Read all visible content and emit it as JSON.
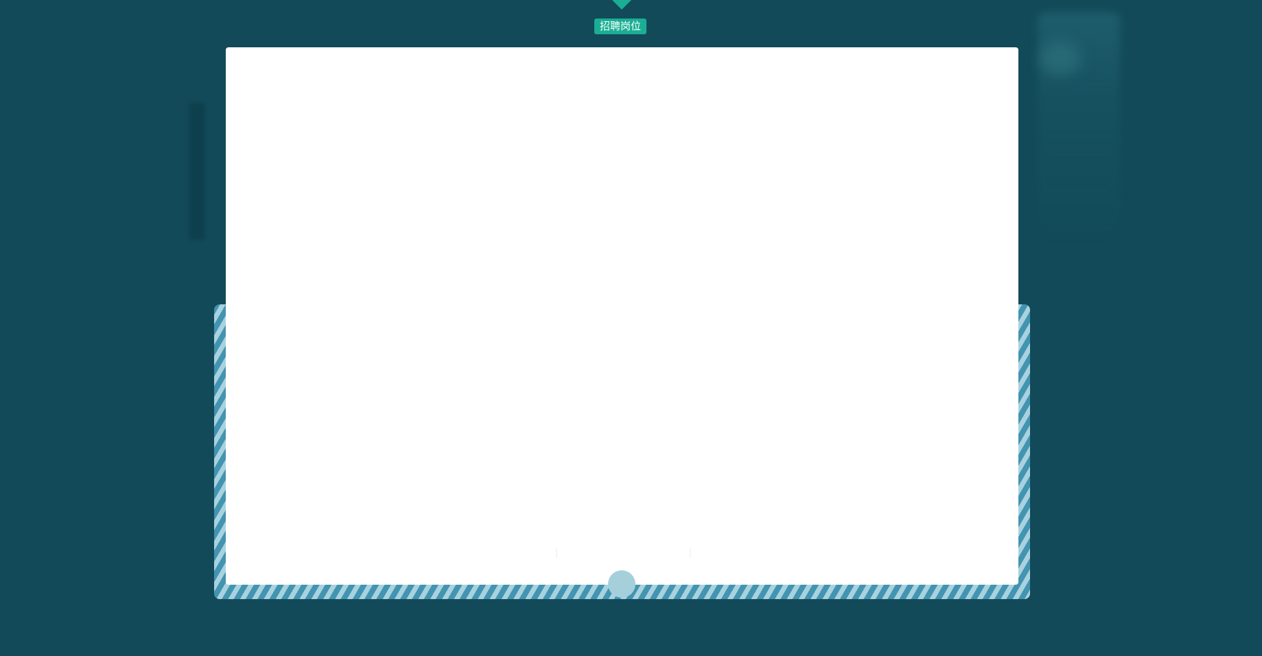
{
  "section": {
    "tag_label": "招聘岗位"
  },
  "colors": {
    "page_background": "#124a59",
    "accent": "#1aae94",
    "stripe_light": "#a8d2df",
    "stripe_dark": "#4394b0",
    "board": "#ffffff"
  },
  "icons": {
    "marker": "caret-down-icon",
    "pager": "dot-indicator"
  }
}
